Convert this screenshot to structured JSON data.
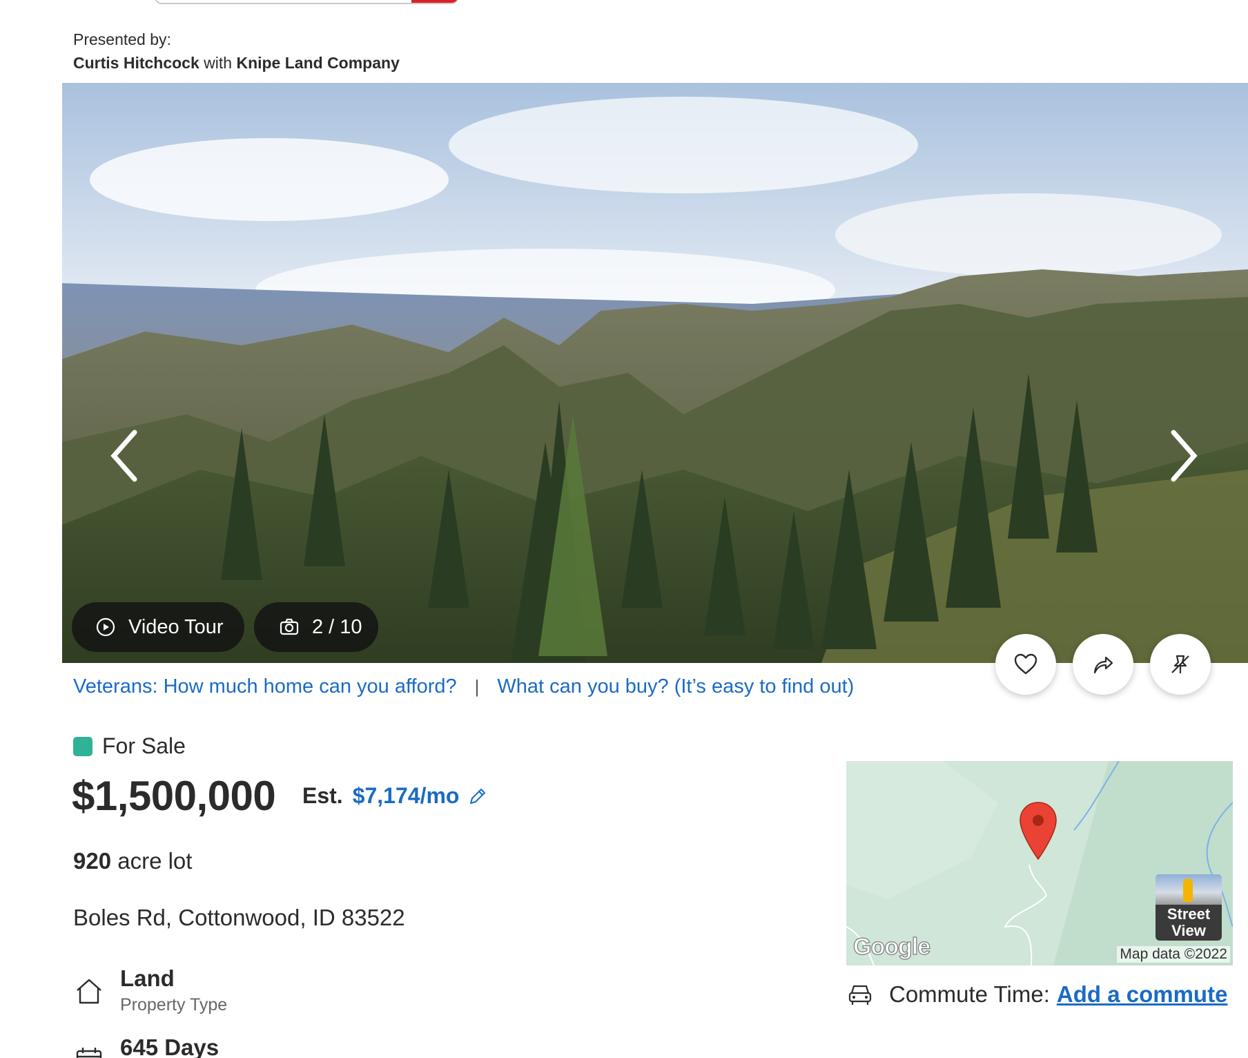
{
  "presented": {
    "label": "Presented by:",
    "agent": "Curtis Hitchcock",
    "with": "with",
    "company": "Knipe Land Company"
  },
  "gallery": {
    "video_label": "Video Tour",
    "photo_counter": "2 / 10"
  },
  "promo": {
    "veterans": "Veterans: How much home can you afford?",
    "separator": "|",
    "buy": "What can you buy? (It’s easy to find out)"
  },
  "listing": {
    "status": "For Sale",
    "status_color": "#2fb295",
    "price": "$1,500,000",
    "est_label": "Est.",
    "est_monthly": "$7,174/mo",
    "lot_size": "920",
    "lot_unit": "acre lot",
    "address": "Boles Rd, Cottonwood, ID 83522"
  },
  "facts": [
    {
      "value": "Land",
      "label": "Property Type",
      "icon": "house-icon"
    },
    {
      "value": "645 Days",
      "label": "",
      "icon": "calendar-icon"
    }
  ],
  "map": {
    "logo": "Google",
    "attribution": "Map data ©2022",
    "street_view": "Street View"
  },
  "commute": {
    "label": "Commute Time:",
    "link": "Add a commute"
  },
  "colors": {
    "link": "#1a6bc4",
    "brand_red": "#d92228",
    "text": "#2b2b2b"
  }
}
